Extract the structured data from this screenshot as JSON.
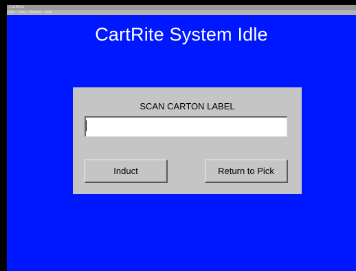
{
  "window": {
    "title": "CartRite"
  },
  "menubar": {
    "items": [
      {
        "label": "File"
      },
      {
        "label": "Tools"
      },
      {
        "label": "Reports"
      },
      {
        "label": "Help"
      }
    ]
  },
  "main": {
    "title": "CartRite System Idle"
  },
  "dialog": {
    "prompt": "SCAN CARTON LABEL",
    "scan_value": "",
    "induct_label": "Induct",
    "return_label": "Return to Pick"
  },
  "colors": {
    "background": "#0018ff",
    "dialog": "#c5c5c5",
    "title_text": "#ffffff"
  }
}
